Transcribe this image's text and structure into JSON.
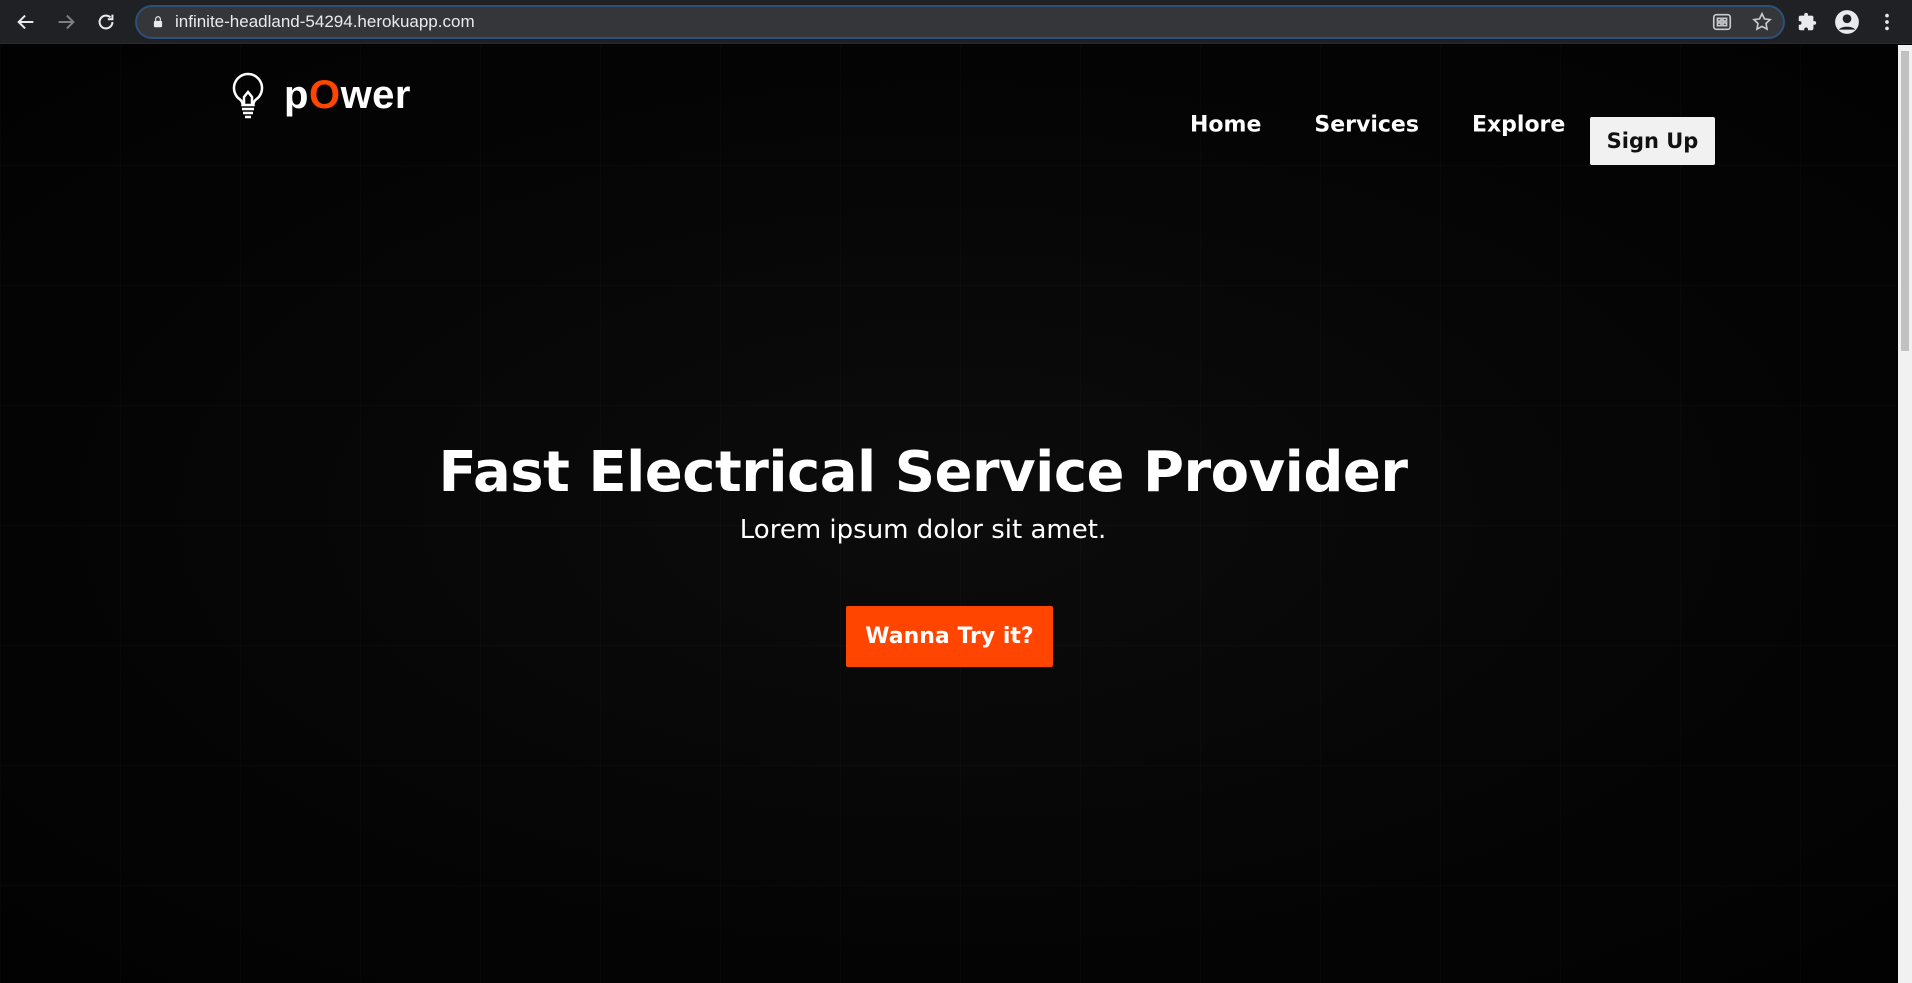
{
  "browser": {
    "url": "infinite-headland-54294.herokuapp.com",
    "icons": [
      "back-icon",
      "forward-icon",
      "reload-icon",
      "lock-icon",
      "apps-icon",
      "star-icon",
      "extensions-icon",
      "profile-icon",
      "menu-icon"
    ]
  },
  "site": {
    "brand_prefix": "p",
    "brand_accent": "O",
    "brand_suffix": "wer",
    "nav": [
      "Home",
      "Services",
      "Explore"
    ],
    "signup_label": "Sign Up",
    "hero_title": "Fast Electrical Service Provider",
    "hero_subtitle": "Lorem ipsum dolor sit amet.",
    "cta_label": "Wanna Try it?"
  },
  "colors": {
    "accent": "#ff4500",
    "background": "#000000",
    "signup_bg": "#f1f1f1"
  }
}
